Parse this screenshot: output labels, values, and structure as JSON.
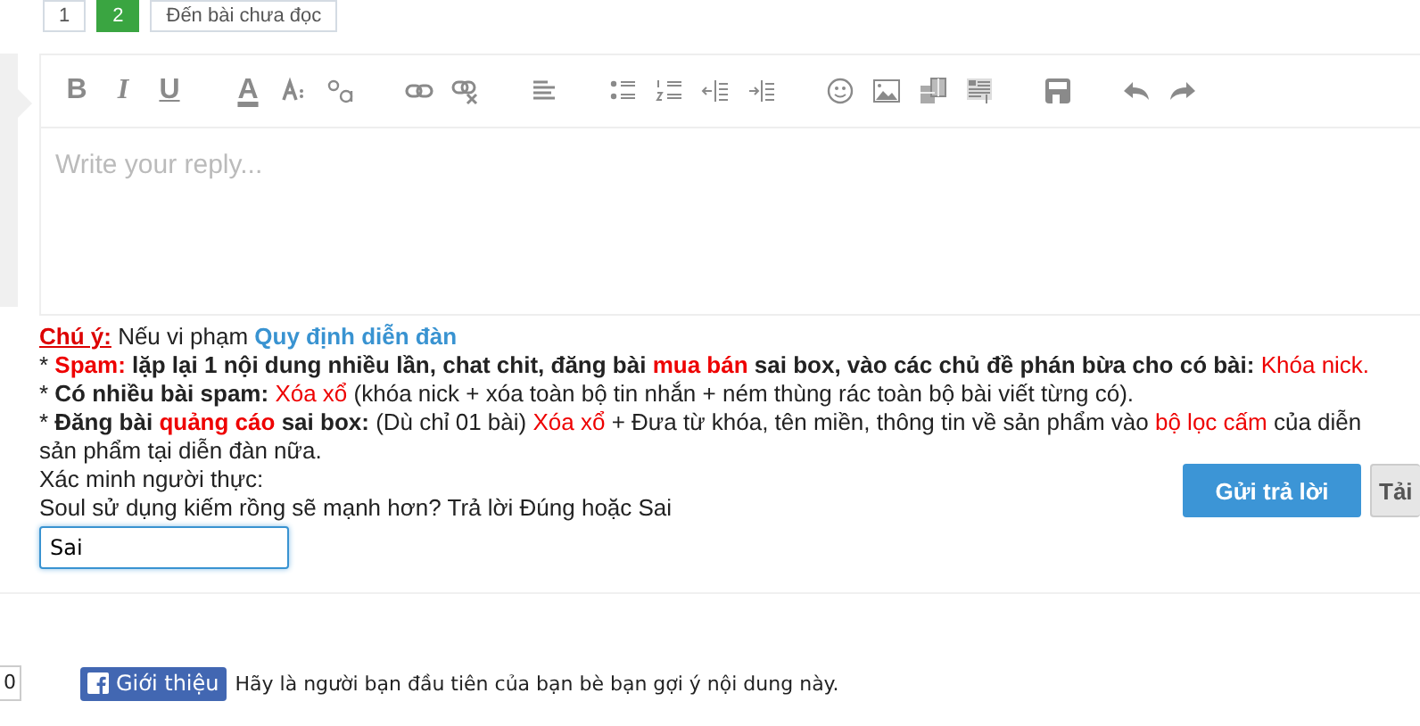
{
  "pagination": {
    "pages": [
      {
        "label": "1",
        "selected": false
      },
      {
        "label": "2",
        "selected": true
      }
    ],
    "unread_link": "Đến bài chưa đọc"
  },
  "editor": {
    "toolbar": [
      {
        "kind": "bold",
        "label": "B"
      },
      {
        "kind": "italic",
        "label": "I"
      },
      {
        "kind": "underline",
        "label": "U"
      },
      {
        "kind": "sep"
      },
      {
        "kind": "color",
        "label": "A"
      },
      {
        "kind": "size"
      },
      {
        "kind": "font"
      },
      {
        "kind": "sep"
      },
      {
        "kind": "link"
      },
      {
        "kind": "unlink"
      },
      {
        "kind": "sep"
      },
      {
        "kind": "align"
      },
      {
        "kind": "sep"
      },
      {
        "kind": "bullets"
      },
      {
        "kind": "numbers"
      },
      {
        "kind": "outdent"
      },
      {
        "kind": "indent"
      },
      {
        "kind": "sep"
      },
      {
        "kind": "smilie"
      },
      {
        "kind": "image"
      },
      {
        "kind": "media"
      },
      {
        "kind": "quote"
      },
      {
        "kind": "sep"
      },
      {
        "kind": "save"
      },
      {
        "kind": "sep"
      },
      {
        "kind": "undo"
      },
      {
        "kind": "redo"
      }
    ],
    "placeholder": "Write your reply..."
  },
  "notices": [
    [
      {
        "kind": "heading",
        "text": "Chú ý:"
      },
      {
        "kind": "plain",
        "text": " Nếu vi phạm "
      },
      {
        "kind": "link",
        "text": "Quy định diễn đàn"
      }
    ],
    [
      {
        "kind": "plain",
        "text": "* "
      },
      {
        "kind": "warning",
        "text": "Spam:"
      },
      {
        "kind": "emphasis",
        "text": " lặp lại 1 nội dung nhiều lần, chat chit, đăng bài "
      },
      {
        "kind": "warning",
        "text": "mua bán"
      },
      {
        "kind": "emphasis",
        "text": " sai box, vào các chủ đề phán bừa cho có bài: "
      },
      {
        "kind": "penalty",
        "text": "Khóa nick."
      }
    ],
    [
      {
        "kind": "plain",
        "text": "* "
      },
      {
        "kind": "emphasis",
        "text": "Có nhiều bài spam: "
      },
      {
        "kind": "penalty",
        "text": "Xóa xổ"
      },
      {
        "kind": "plain",
        "text": " (khóa nick + xóa toàn bộ tin nhắn + ném thùng rác toàn bộ bài viết từng có)."
      }
    ],
    [
      {
        "kind": "plain",
        "text": "* "
      },
      {
        "kind": "emphasis",
        "text": "Đăng bài "
      },
      {
        "kind": "warning",
        "text": "quảng cáo"
      },
      {
        "kind": "emphasis",
        "text": " sai box:"
      },
      {
        "kind": "plain",
        "text": " (Dù chỉ 01 bài) "
      },
      {
        "kind": "penalty",
        "text": "Xóa xổ"
      },
      {
        "kind": "plain",
        "text": " + Đưa từ khóa, tên miền, thông tin về sản phẩm vào "
      },
      {
        "kind": "penalty",
        "text": "bộ lọc cấm"
      },
      {
        "kind": "plain",
        "text": " của diễn"
      }
    ],
    [
      {
        "kind": "plain",
        "text": "sản phẩm tại diễn đàn nữa."
      }
    ]
  ],
  "captcha": {
    "label": "Xác minh người thực:",
    "question": "Soul sử dụng kiếm rồng sẽ mạnh hơn? Trả lời Đúng hoặc Sai",
    "value": "Sai"
  },
  "buttons": [
    {
      "kind": "primary",
      "label": "Gửi trả lời"
    },
    {
      "kind": "secondary",
      "label": "Tải"
    }
  ],
  "facebook": {
    "count": "0",
    "button": "Giới thiệu",
    "text": "Hãy là người bạn đầu tiên của bạn bè bạn gợi ý nội dung này."
  }
}
